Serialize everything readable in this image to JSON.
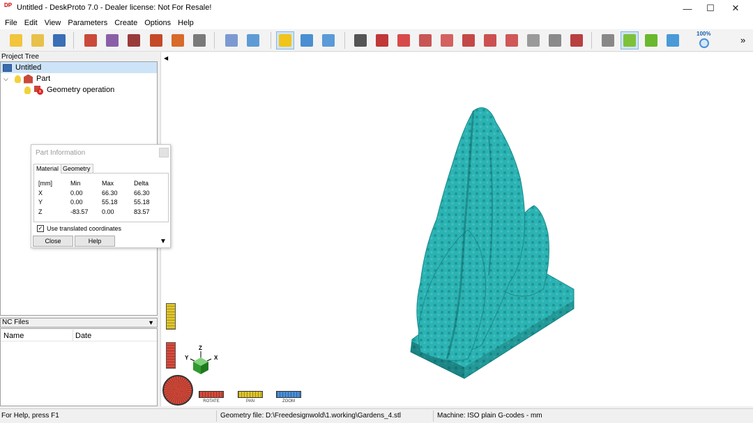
{
  "window": {
    "app_logo": "DP",
    "title": "Untitled - DeskProto 7.0 - Dealer license: Not For Resale!",
    "minimize_glyph": "—",
    "maximize_glyph": "☐",
    "close_glyph": "✕"
  },
  "menu": [
    "File",
    "Edit",
    "View",
    "Parameters",
    "Create",
    "Options",
    "Help"
  ],
  "toolbar": {
    "zoom_label": "100%",
    "overflow_glyph": "»",
    "buttons": [
      {
        "icon": "new-project-icon",
        "color": "#f2c53d"
      },
      {
        "icon": "open-folder-icon",
        "color": "#e8c14a"
      },
      {
        "icon": "save-icon",
        "color": "#3b6fb6"
      },
      {
        "icon": "import-geometry-icon",
        "color": "#c94a3a"
      },
      {
        "icon": "import-vector-icon",
        "color": "#8a5fa8"
      },
      {
        "icon": "import-bitmap-icon",
        "color": "#9a3b3b"
      },
      {
        "icon": "edit-part-icon",
        "color": "#c44a2a"
      },
      {
        "icon": "drawing-icon",
        "color": "#d86a2a"
      },
      {
        "icon": "export-icon",
        "color": "#7a7a7a"
      },
      {
        "icon": "toolpath-icon",
        "color": "#7c9ad1"
      },
      {
        "icon": "simulation-icon",
        "color": "#5e9bd6"
      },
      {
        "icon": "info-icon",
        "color": "#f0c419"
      },
      {
        "icon": "window-layout-icon",
        "color": "#4a8fd1"
      },
      {
        "icon": "window-view-icon",
        "color": "#5a9bd8"
      },
      {
        "icon": "camera-icon",
        "color": "#555555"
      },
      {
        "icon": "view-iso-icon",
        "color": "#c03838"
      },
      {
        "icon": "view-front-icon",
        "color": "#d84a4a"
      },
      {
        "icon": "view-back-icon",
        "color": "#c85656"
      },
      {
        "icon": "view-left-icon",
        "color": "#d46060"
      },
      {
        "icon": "view-right-icon",
        "color": "#c44848"
      },
      {
        "icon": "view-top-icon",
        "color": "#cc5050"
      },
      {
        "icon": "view-bottom-icon",
        "color": "#d05858"
      },
      {
        "icon": "view-gray-icon",
        "color": "#9a9a9a"
      },
      {
        "icon": "view-gray2-icon",
        "color": "#8a8a8a"
      },
      {
        "icon": "render-icon",
        "color": "#b84040"
      },
      {
        "icon": "render-gray-icon",
        "color": "#888888"
      },
      {
        "icon": "rotate-view-icon",
        "color": "#7dc13a"
      },
      {
        "icon": "pan-view-icon",
        "color": "#6ab82d"
      },
      {
        "icon": "zoom-in-icon",
        "color": "#4a9ad8"
      },
      {
        "icon": "zoom-window-icon",
        "color": "#3f8bcc"
      },
      {
        "icon": "zoom-all-icon",
        "color": "#5aa2dc"
      }
    ]
  },
  "project_tree": {
    "header": "Project Tree",
    "root": "Untitled",
    "part": "Part",
    "operation": "Geometry operation"
  },
  "part_info": {
    "title": "Part Information",
    "tabs": [
      "Material",
      "Geometry"
    ],
    "columns": [
      "[mm]",
      "Min",
      "Max",
      "Delta"
    ],
    "rows": [
      [
        "X",
        "0.00",
        "66.30",
        "66.30"
      ],
      [
        "Y",
        "0.00",
        "55.18",
        "55.18"
      ],
      [
        "Z",
        "-83.57",
        "0.00",
        "83.57"
      ]
    ],
    "checkbox_label": "Use translated coordinates",
    "checkbox_checked": true,
    "close_label": "Close",
    "help_label": "Help"
  },
  "nc_files": {
    "header": "NC Files",
    "columns": [
      "Name",
      "Date"
    ]
  },
  "viewport": {
    "model_color": "#2bb3b3",
    "axis_labels": {
      "x": "X",
      "y": "Y",
      "z": "Z"
    },
    "view_controls": [
      {
        "label": "ROTATE",
        "color": "#d84a3a"
      },
      {
        "label": "PAN",
        "color": "#e0c52a"
      },
      {
        "label": "ZOOM",
        "color": "#4a8fd8"
      }
    ]
  },
  "statusbar": {
    "help": "For Help, press F1",
    "geometry_file": "Geometry file: D:\\Freedesignwold\\1.working\\Gardens_4.stl",
    "machine": "Machine: ISO plain G-codes - mm"
  }
}
